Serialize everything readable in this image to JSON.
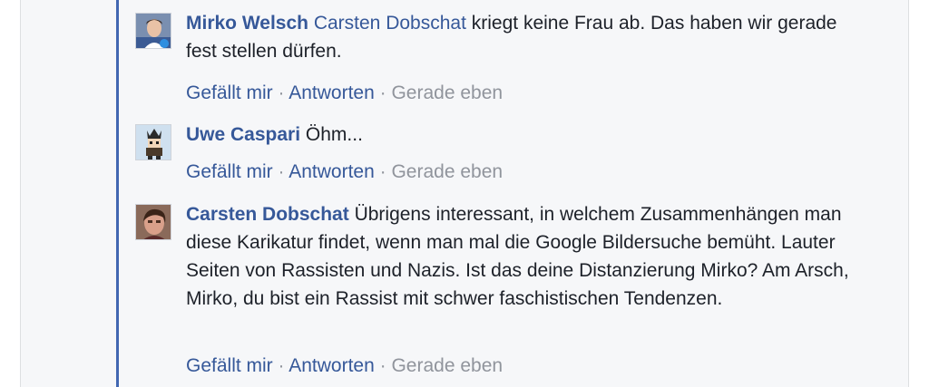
{
  "comments": [
    {
      "author": "Mirko Welsch",
      "mention": "Carsten Dobschat",
      "text": " kriegt keine Frau ab. Das haben wir gerade fest stellen dürfen.",
      "like_label": "Gefällt mir",
      "reply_label": "Antworten",
      "timestamp": "Gerade eben",
      "separator": "·"
    },
    {
      "author": "Uwe Caspari",
      "text": "Öhm...",
      "like_label": "Gefällt mir",
      "reply_label": "Antworten",
      "timestamp": "Gerade eben",
      "separator": "·"
    },
    {
      "author": "Carsten Dobschat",
      "text": "Übrigens interessant, in welchem Zusammenhängen man diese Karikatur findet, wenn man mal die Google Bildersuche bemüht. Lauter Seiten von Rassisten und Nazis. Ist das deine Distanzierung Mirko? Am Arsch, Mirko, du bist ein Rassist mit schwer faschistischen Tendenzen.",
      "like_label": "Gefällt mir",
      "reply_label": "Antworten",
      "timestamp": "Gerade eben",
      "separator": "·"
    }
  ],
  "colors": {
    "link": "#365899",
    "text": "#1d2129",
    "meta": "#90949c",
    "thread_bar": "#4267b2",
    "panel_bg": "#f6f7f9"
  }
}
